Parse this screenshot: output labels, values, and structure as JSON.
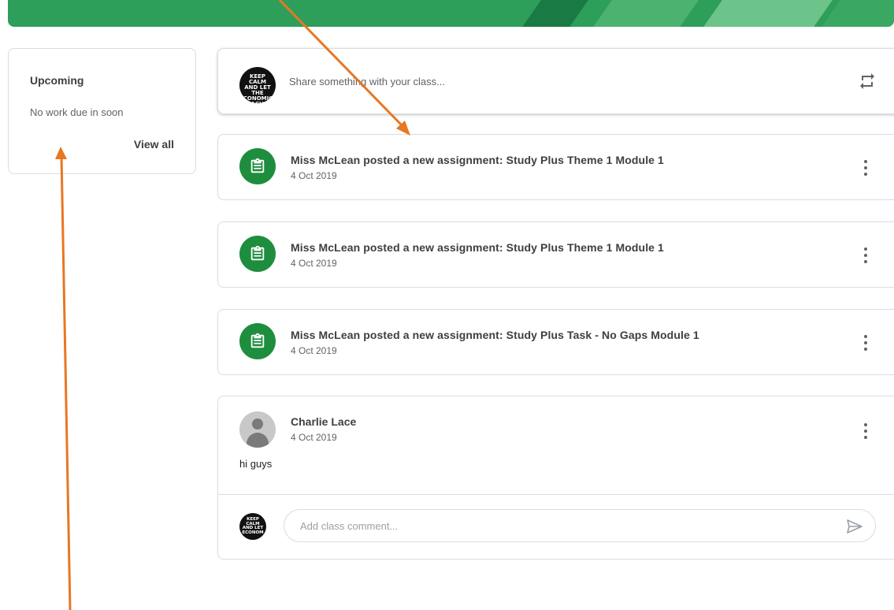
{
  "upcoming": {
    "title": "Upcoming",
    "note": "No work due in soon",
    "view_all": "View all"
  },
  "share": {
    "avatar_text": "KEEP CALM AND LET THE ECONOMICS TEACHER HANDLE IT",
    "placeholder": "Share something with your class..."
  },
  "posts": [
    {
      "title": "Miss McLean posted a new assignment: Study Plus Theme 1 Module 1",
      "date": "4 Oct 2019"
    },
    {
      "title": "Miss McLean posted a new assignment: Study Plus Theme 1 Module 1",
      "date": "4 Oct 2019"
    },
    {
      "title": "Miss McLean posted a new assignment: Study Plus Task - No Gaps Module 1",
      "date": "4 Oct 2019"
    }
  ],
  "comment_post": {
    "author": "Charlie Lace",
    "date": "4 Oct 2019",
    "text": "hi guys",
    "input_placeholder": "Add class comment..."
  },
  "colors": {
    "banner": "#2e9e5b",
    "assignment_icon_bg": "#1e8e3e",
    "annotation_arrow": "#e87722"
  },
  "icons": [
    "repost-icon",
    "assignment-icon",
    "more-vert-icon",
    "send-icon",
    "default-avatar-icon"
  ]
}
